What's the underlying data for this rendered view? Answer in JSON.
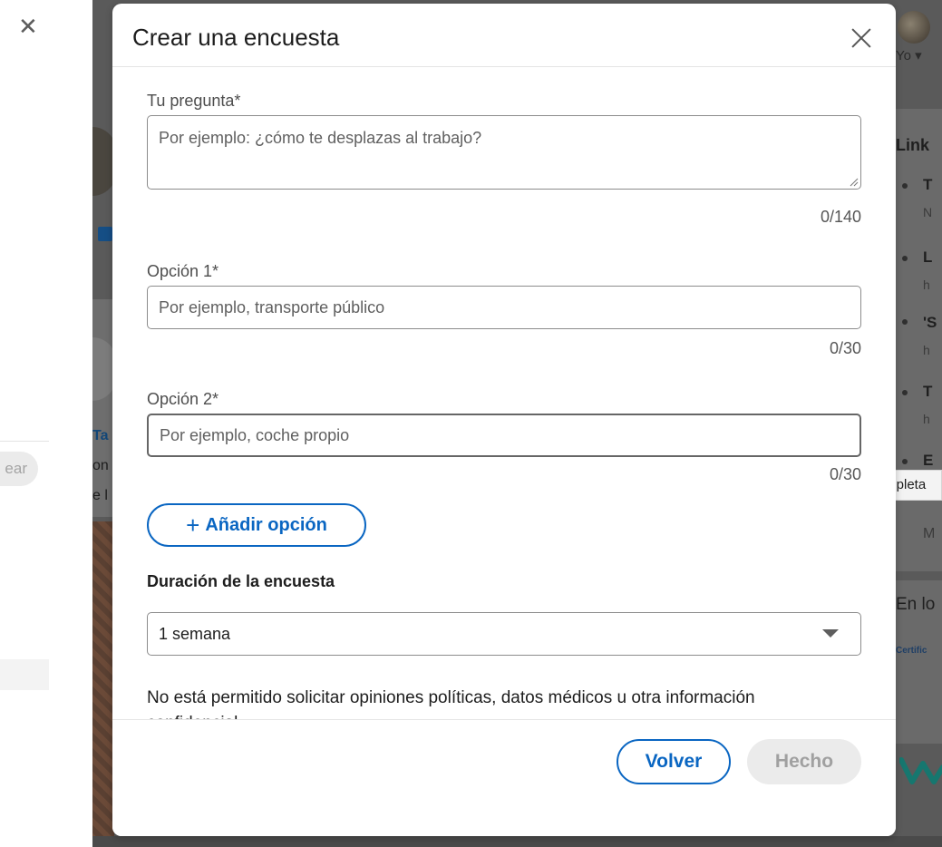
{
  "left_page": {
    "pill_label": "ear"
  },
  "background": {
    "profile_menu": "Yo",
    "right_title": "Link",
    "right_items": [
      {
        "title": "T",
        "sub": "N"
      },
      {
        "title": "L",
        "sub": "h"
      },
      {
        "title": "'S",
        "sub": "h"
      },
      {
        "title": "T",
        "sub": "h"
      },
      {
        "title": "E",
        "sub": ""
      }
    ],
    "right_more": "M",
    "right_section2": "En lo",
    "right_cert": "Certific",
    "left_name": "Ta",
    "left_line1": "on",
    "left_line2": "e l"
  },
  "tooltip": "Completa",
  "modal": {
    "title": "Crear una encuesta",
    "question": {
      "label": "Tu pregunta*",
      "placeholder": "Por ejemplo: ¿cómo te desplazas al trabajo?",
      "counter": "0/140"
    },
    "options": [
      {
        "label": "Opción 1*",
        "placeholder": "Por ejemplo, transporte público",
        "counter": "0/30"
      },
      {
        "label": "Opción 2*",
        "placeholder": "Por ejemplo, coche propio",
        "counter": "0/30"
      }
    ],
    "add_option": "Añadir opción",
    "duration_label": "Duración de la encuesta",
    "duration_value": "1 semana",
    "notice": "No está permitido solicitar opiniones políticas, datos médicos u otra información confidencial.",
    "back_button": "Volver",
    "done_button": "Hecho"
  },
  "colors": {
    "accent": "#0a66c2",
    "overlay": "#5a5a5a",
    "disabled_bg": "#ebebeb"
  }
}
